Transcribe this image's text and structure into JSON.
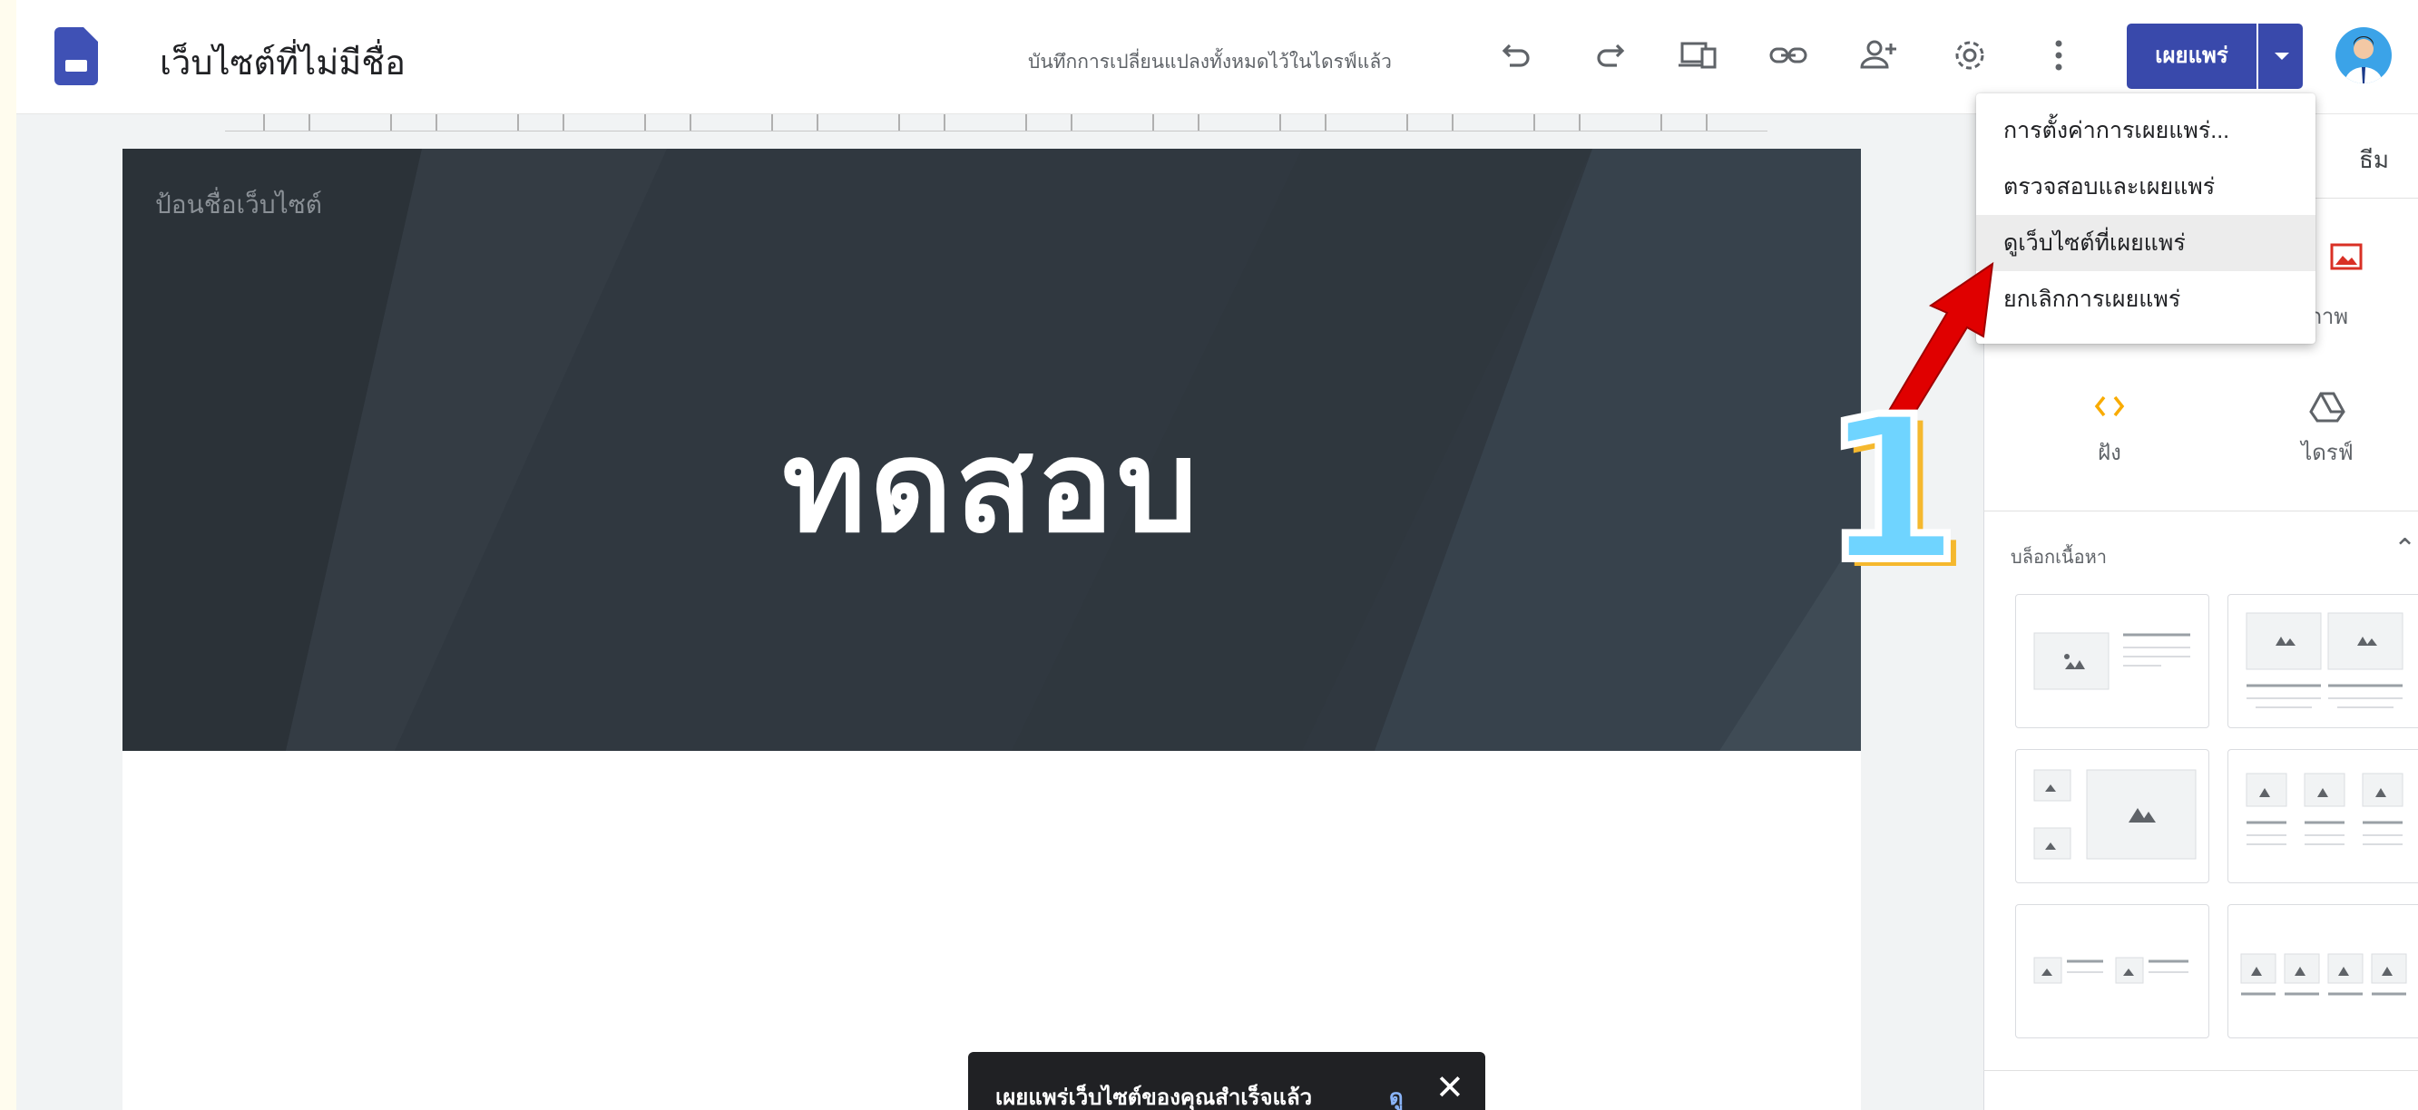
{
  "app": {
    "title": "เว็บไซต์ที่ไม่มีชื่อ",
    "save_status": "บันทึกการเปลี่ยนแปลงทั้งหมดไว้ในไดรฟ์แล้ว"
  },
  "toolbar": {
    "icons": [
      "undo-icon",
      "redo-icon",
      "preview-icon",
      "link-icon",
      "share-icon",
      "settings-icon",
      "more-icon"
    ],
    "publish_label": "เผยแพร่"
  },
  "publish_menu": {
    "items": [
      {
        "label": "การตั้งค่าการเผยแพร่..."
      },
      {
        "label": "ตรวจสอบและเผยแพร่"
      },
      {
        "label": "ดูเว็บไซต์ที่เผยแพร่",
        "highlighted": true
      },
      {
        "label": "ยกเลิกการเผยแพร่"
      }
    ]
  },
  "page": {
    "site_name_placeholder": "ป้อนชื่อเว็บไซต์",
    "hero_title": "ทดสอบ"
  },
  "right_panel": {
    "tab_theme": "ธีม",
    "insert": {
      "image_label_partial": "ภาพ",
      "embed_label": "ฝัง",
      "drive_label": "ไดรฟ์"
    },
    "content_blocks_title": "บล็อกเนื้อหา"
  },
  "toast": {
    "message": "เผยแพร่เว็บไซต์ของคุณสำเร็จแล้ว",
    "action": "ดู"
  },
  "annotation": {
    "step_number": "1"
  },
  "colors": {
    "publish_button": "#3949ab",
    "header_bg": "#303840",
    "annotation_arrow": "#e00000",
    "step_fill": "#6fd4ff",
    "step_shadow": "#f5b82e"
  }
}
